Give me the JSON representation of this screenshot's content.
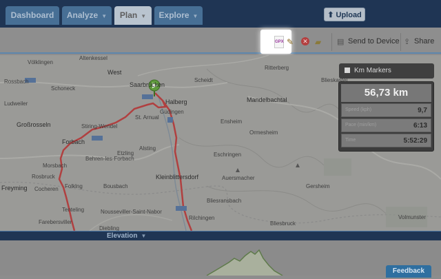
{
  "nav": {
    "tabs": [
      {
        "label": "Dashboard"
      },
      {
        "label": "Analyze"
      },
      {
        "label": "Plan"
      },
      {
        "label": "Explore"
      }
    ],
    "upload_label": "Upload"
  },
  "toolbar": {
    "gpx_label": "GPX",
    "send_label": "Send to Device",
    "share_label": "Share"
  },
  "map": {
    "places": {
      "volklingen": "Völklingen",
      "altenkessel": "Altenkessel",
      "west": "West",
      "saarbrucken": "Saarbrücken",
      "halberg": "Halberg",
      "rossbach": "Rossbach",
      "schoneck": "Schoneck",
      "ludweiler": "Ludweiler",
      "grossrosseln": "Großrosseln",
      "stiring": "Stiring-Wendel",
      "st_arnual": "St. Arnual",
      "gudingen": "Güdingen",
      "forbach": "Forbach",
      "etzling": "Etzling",
      "alsting": "Alsting",
      "behren": "Behren-les-Forbach",
      "morsbach": "Morsbach",
      "rosbruck": "Rosbruck",
      "cocheren": "Cocheren",
      "freyming": "Freyming",
      "folklng": "Folklng",
      "bousbach": "Bousbach",
      "kleinblittersdorf": "Kleinblittersdorf",
      "tenteling": "Tenteling",
      "nousseviller": "Nousseviller-Saint-Nabor",
      "farebersviller": "Farebersviller",
      "diebling": "Diebling",
      "mandelbachtal": "Mandelbachtal",
      "ensheim": "Ensheim",
      "ormesheim": "Ormesheim",
      "eschringen": "Eschringen",
      "auersmacher": "Auersmacher",
      "rilchingen": "Rilchingen",
      "bliesransbach": "Bliesransbach",
      "gersheim": "Gersheim",
      "bliesbruck": "Bliesbruck",
      "volmunster": "Volmunster",
      "bliesk": "Blieskastel",
      "rittersberg": "Ritterberg",
      "schoft": "Scheidt"
    }
  },
  "km_markers": {
    "label": "Km Markers",
    "distance": "56,73 km",
    "rows": [
      {
        "label": "Speed (kph)",
        "value": "9,7"
      },
      {
        "label": "Pace (min/km)",
        "value": "6:13"
      },
      {
        "label": "Time",
        "value": "5:52:29"
      }
    ]
  },
  "elevation_label": "Elevation",
  "feedback_label": "Feedback",
  "colors": {
    "nav_bg": "#1f3554",
    "tab_bg": "#476f95",
    "route": "#b04040",
    "accent": "#2f6fa0"
  }
}
